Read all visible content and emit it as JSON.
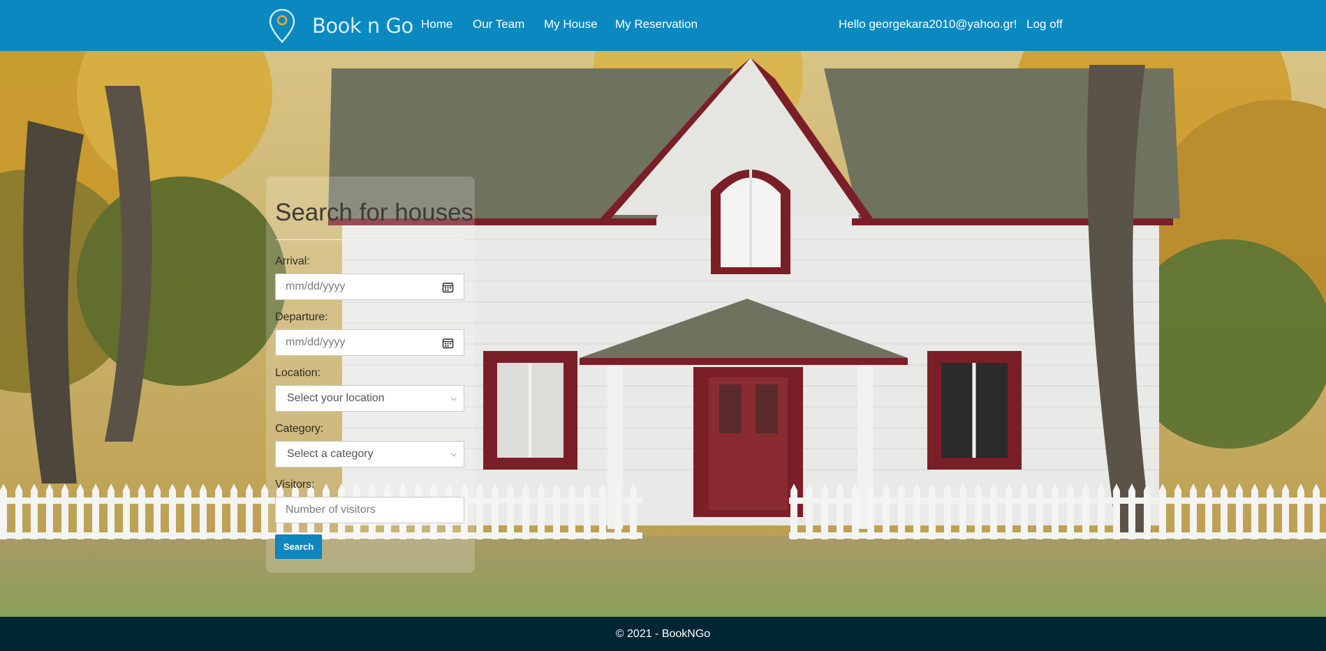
{
  "brand": {
    "name": "Book n Go",
    "icon": "map-pin-icon"
  },
  "nav": {
    "home": "Home",
    "team": "Our Team",
    "house": "My House",
    "reservation": "My Reservation",
    "greeting": "Hello georgekara2010@yahoo.gr!",
    "logoff": "Log off"
  },
  "search": {
    "title": "Search for houses",
    "arrival_label": "Arrival:",
    "arrival_placeholder": "mm/dd/yyyy",
    "departure_label": "Departure:",
    "departure_placeholder": "mm/dd/yyyy",
    "location_label": "Location:",
    "location_selected": "Select your location",
    "category_label": "Category:",
    "category_selected": "Select a category",
    "visitors_label": "Visitors:",
    "visitors_placeholder": "Number of visitors",
    "button": "Search"
  },
  "footer": {
    "text": "© 2021 - BookNGo"
  },
  "colors": {
    "navbar": "#0989c0",
    "footer": "#022533",
    "button": "#0e86bf"
  }
}
